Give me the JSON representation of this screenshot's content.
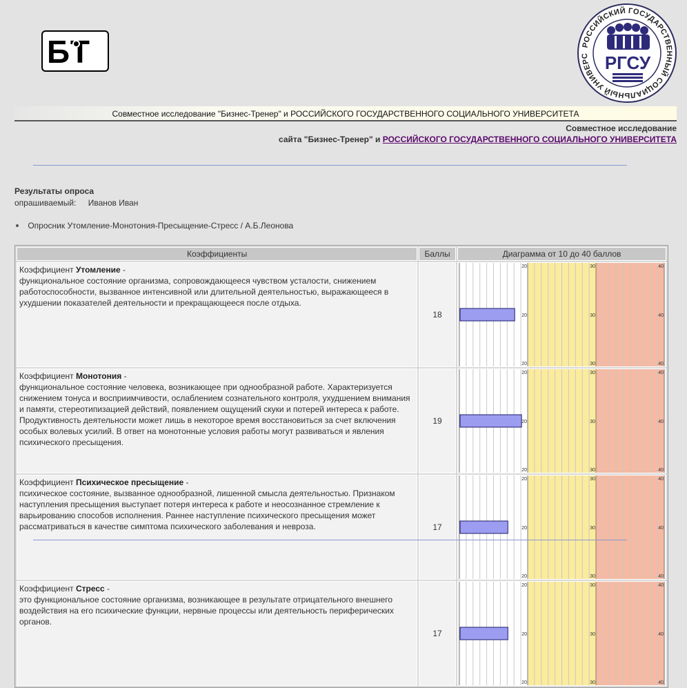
{
  "header": {
    "logo_left": "БТ",
    "logo_right": "РГСУ",
    "logo_right_ring": "РОССИЙСКИЙ ГОСУДАРСТВЕННЫЙ СОЦИАЛЬНЫЙ УНИВЕРСИТЕТ",
    "banner": "Совместное исследование \"Бизнес-Тренер\" и РОССИЙСКОГО ГОСУДАРСТВЕННОГО СОЦИАЛЬНОГО УНИВЕРСИТЕТА",
    "coop_line1": "Совместное исследование",
    "coop_line2_prefix": "сайта \"Бизнес-Тренер\" и",
    "coop_link": "РОССИЙСКОГО ГОСУДАРСТВЕННОГО СОЦИАЛЬНОГО УНИВЕРСИТЕТА"
  },
  "results": {
    "title": "Результаты опроса",
    "respondent_label": "опрашиваемый:",
    "respondent_name": "Иванов Иван",
    "survey_name": "Опросник Утомление-Монотония-Пресыщение-Стресс / А.Б.Леонова"
  },
  "table": {
    "col_coef": "Коэффициенты",
    "col_score": "Баллы",
    "col_diagram": "Диаграмма от 10 до 40 баллов",
    "rows": [
      {
        "prefix": "Коэффициент",
        "name": "Утомление",
        "suffix": " -",
        "description": "функциональное состояние организма, сопровождающееся чувством усталости, снижением работоспособности, вызванное интенсивной или длительной деятельностью, выражающееся в ухудшении показателей деятельности и прекращающееся после отдыха.",
        "score": "18"
      },
      {
        "prefix": "Коэффициент",
        "name": "Монотония",
        "suffix": " -",
        "description": "функциональное состояние человека, возникающее при однообразной работе. Характеризуется снижением тонуса и восприимчивости, ослаблением сознательного контроля, ухудшением внимания и памяти, стереотипизацией действий, появлением ощущений скуки и потерей интереса к работе. Продуктивность деятельности может лишь в некоторое время восстановиться за счет включения особых волевых усилий. В ответ на монотонные условия работы могут развиваться и явления психического пресыщения.",
        "score": "19"
      },
      {
        "prefix": "Коэффициент",
        "name": "Психическое пресыщение",
        "suffix": " -",
        "description": "психическое состояние, вызванное однообразной, лишенной смысла деятельностью. Признаком наступления пресыщения выступает потеря интереса к работе и неосознанное стремление к варьированию способов исполнения. Раннее наступление психического пресыщения может рассматриваться в качестве симптома психического заболевания и невроза.",
        "score": "17"
      },
      {
        "prefix": "Коэффициент",
        "name": "Стресс",
        "suffix": " -",
        "description": "это функциональное состояние организма, возникающее в результате отрицательного внешнего воздействия на его психические функции, нервные процессы или деятельность периферических органов.",
        "score": "17"
      }
    ]
  },
  "chart_data": {
    "type": "bar",
    "title": "Диаграмма от 10 до 40 баллов",
    "categories": [
      "Утомление",
      "Монотония",
      "Психическое пресыщение",
      "Стресс"
    ],
    "values": [
      18,
      19,
      17,
      17
    ],
    "xlim": [
      10,
      40
    ],
    "zones": [
      {
        "from": 10,
        "to": 20,
        "color": "#ffffff"
      },
      {
        "from": 20,
        "to": 30,
        "color": "#fbeb9c"
      },
      {
        "from": 30,
        "to": 40,
        "color": "#f6b9a2"
      }
    ],
    "tick_labels": [
      "20",
      "30",
      "40"
    ],
    "bar_color": "#9c9cf0",
    "bar_border": "#1b1b6b",
    "grid": true
  }
}
